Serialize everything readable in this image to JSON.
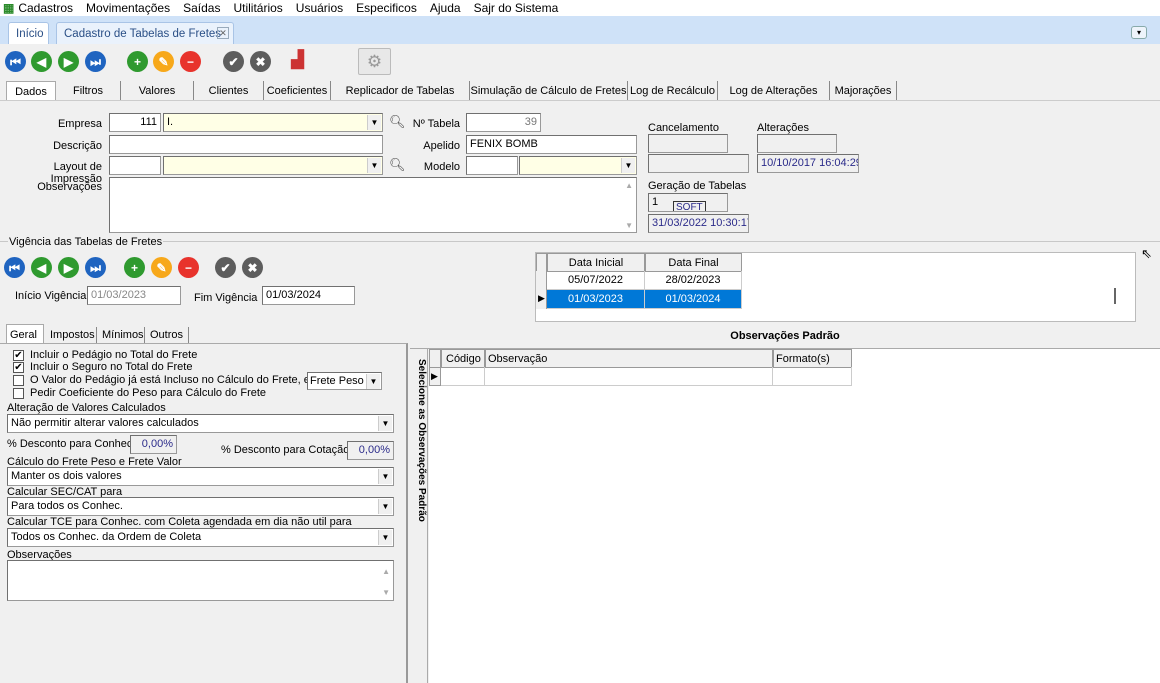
{
  "menu": {
    "items": [
      "Cadastros",
      "Movimentações",
      "Saídas",
      "Utilitários",
      "Usuários",
      "Especificos",
      "Ajuda",
      "Sajr do Sistema"
    ]
  },
  "doc_tabs": [
    "Início",
    "Cadastro de Tabelas de Fretes"
  ],
  "tabs": [
    "Dados",
    "Filtros",
    "Valores",
    "Clientes",
    "Coeficientes",
    "Replicador de Tabelas",
    "Simulação de Cálculo de Fretes",
    "Log de Recálculo",
    "Log de Alterações",
    "Majorações"
  ],
  "form": {
    "empresa_label": "Empresa",
    "empresa_code": "111",
    "empresa_name": "I.",
    "ntabela_label": "Nº Tabela",
    "ntabela": "39",
    "descricao_label": "Descrição",
    "descricao": "",
    "apelido_label": "Apelido",
    "apelido": "FENIX BOMB",
    "layout_label": "Layout de Impressão",
    "modelo_label": "Modelo",
    "obs_label": "Observações",
    "cancelamento_label": "Cancelamento",
    "alteracoes_label": "Alterações",
    "alteracoes_date": "10/10/2017 16:04:29",
    "geracao_label": "Geração de Tabelas",
    "geracao_code": "1",
    "geracao_user": "SOFT",
    "geracao_date": "31/03/2022 10:30:17"
  },
  "vigencia": {
    "group_label": "Vigência das Tabelas de Fretes",
    "inicio_label": "Início Vigência",
    "inicio": "01/03/2023",
    "fim_label": "Fim Vigência",
    "fim": "01/03/2024",
    "columns": [
      "Data Inicial",
      "Data Final"
    ],
    "rows": [
      [
        "05/07/2022",
        "28/02/2023"
      ],
      [
        "01/03/2023",
        "01/03/2024"
      ]
    ],
    "selected_row": 1
  },
  "subtabs": [
    "Geral",
    "Impostos",
    "Mínimos",
    "Outros"
  ],
  "geral": {
    "checks": [
      {
        "label": "Incluir o Pedágio no Total do Frete",
        "checked": true
      },
      {
        "label": "Incluir o Seguro no Total do Frete",
        "checked": true
      },
      {
        "label": "O Valor do Pedágio já está Incluso no Cálculo do Frete, em",
        "checked": false
      },
      {
        "label": "Pedir Coeficiente do Peso para Cálculo do Frete",
        "checked": false
      }
    ],
    "frete_peso": "Frete Peso",
    "alteracao_label": "Alteração de Valores Calculados",
    "alteracao": "Não permitir alterar valores calculados",
    "desc_conhec_label": "% Desconto para Conhec.",
    "desc_conhec": "0,00%",
    "desc_cot_label": "% Desconto para Cotação",
    "desc_cot": "0,00%",
    "calculo_label": "Cálculo do Frete Peso e Frete Valor",
    "calculo": "Manter os dois valores",
    "sec_label": "Calcular SEC/CAT para",
    "sec": "Para todos os Conhec.",
    "tce_label": "Calcular TCE para Conhec. com  Coleta agendada em dia não util para",
    "tce": "Todos os Conhec. da Ordem de Coleta",
    "obs_label": "Observações"
  },
  "obs_padrao": {
    "title": "Observações Padrão",
    "side_label": "Selecione as Observações Padrão",
    "columns": [
      "Código",
      "Observação",
      "Formato(s)"
    ]
  },
  "colors": {
    "selection": "#0078d7",
    "tabstrip": "#cfe2f8",
    "input_yellow": "#ffffe6"
  }
}
